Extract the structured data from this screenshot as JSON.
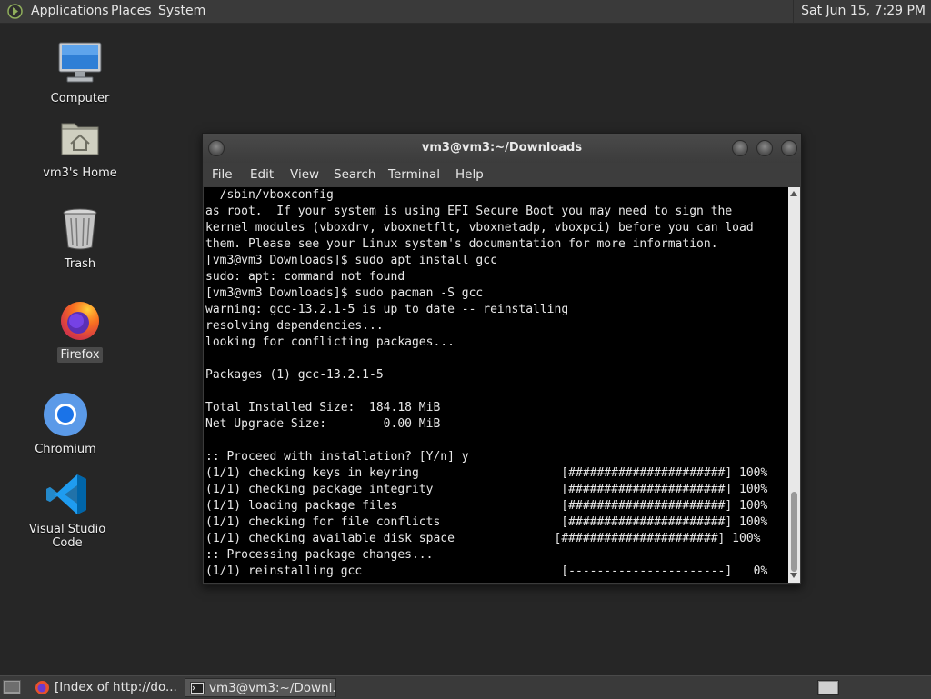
{
  "top_panel": {
    "menus": [
      "Applications",
      "Places",
      "System"
    ],
    "clock": "Sat Jun 15,  7:29 PM"
  },
  "desktop": {
    "icons": [
      {
        "label": "Computer",
        "icon": "computer-icon"
      },
      {
        "label": "vm3's Home",
        "icon": "home-folder-icon"
      },
      {
        "label": "Trash",
        "icon": "trash-icon"
      },
      {
        "label": "Firefox",
        "icon": "firefox-icon"
      },
      {
        "label": "Chromium",
        "icon": "chromium-icon"
      },
      {
        "label": "Visual Studio Code",
        "icon": "vscode-icon"
      }
    ]
  },
  "terminal": {
    "title": "vm3@vm3:~/Downloads",
    "menu": [
      "File",
      "Edit",
      "View",
      "Search",
      "Terminal",
      "Help"
    ],
    "lines": [
      "  /sbin/vboxconfig",
      "as root.  If your system is using EFI Secure Boot you may need to sign the",
      "kernel modules (vboxdrv, vboxnetflt, vboxnetadp, vboxpci) before you can load",
      "them. Please see your Linux system's documentation for more information.",
      "[vm3@vm3 Downloads]$ sudo apt install gcc",
      "sudo: apt: command not found",
      "[vm3@vm3 Downloads]$ sudo pacman -S gcc",
      "warning: gcc-13.2.1-5 is up to date -- reinstalling",
      "resolving dependencies...",
      "looking for conflicting packages...",
      "",
      "Packages (1) gcc-13.2.1-5",
      "",
      "Total Installed Size:  184.18 MiB",
      "Net Upgrade Size:        0.00 MiB",
      "",
      ":: Proceed with installation? [Y/n] y",
      "(1/1) checking keys in keyring                    [######################] 100%",
      "(1/1) checking package integrity                  [######################] 100%",
      "(1/1) loading package files                       [######################] 100%",
      "(1/1) checking for file conflicts                 [######################] 100%",
      "(1/1) checking available disk space              [######################] 100%",
      ":: Processing package changes...",
      "(1/1) reinstalling gcc                            [----------------------]   0%"
    ]
  },
  "taskbar": {
    "tasks": [
      {
        "label": "[Index of http://do...",
        "icon": "firefox-icon",
        "active": false
      },
      {
        "label": "vm3@vm3:~/Downl...",
        "icon": "terminal-icon",
        "active": true
      }
    ]
  },
  "colors": {
    "desktop_bg": "#262626",
    "panel_bg": "#3a3a3a",
    "terminal_bg": "#000000",
    "terminal_fg": "#e8e8e8"
  }
}
